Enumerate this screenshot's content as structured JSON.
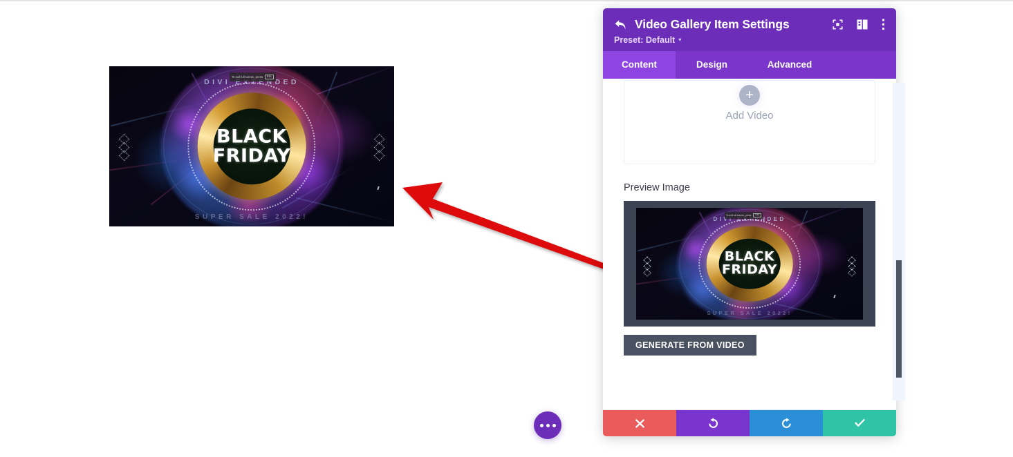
{
  "panel": {
    "title": "Video Gallery Item Settings",
    "back_icon": "back-arrow-icon",
    "header_icons": [
      "focus-target-icon",
      "panel-layout-icon",
      "vertical-dots-icon"
    ],
    "preset_label": "Preset: Default",
    "preset_caret": "▾",
    "tabs": [
      {
        "label": "Content",
        "active": true
      },
      {
        "label": "Design",
        "active": false
      },
      {
        "label": "Advanced",
        "active": false
      }
    ],
    "add_video": {
      "plus_glyph": "+",
      "label": "Add Video"
    },
    "preview_image": {
      "section_label": "Preview Image",
      "generate_button": "GENERATE FROM VIDEO"
    },
    "action_bar": [
      {
        "name": "cancel",
        "glyph": "✖",
        "color": "#ea5c5c"
      },
      {
        "name": "undo",
        "glyph": "↺",
        "color": "#7a35cf"
      },
      {
        "name": "redo",
        "glyph": "↻",
        "color": "#2a8fd6"
      },
      {
        "name": "save",
        "glyph": "✔",
        "color": "#2fc4a5"
      }
    ]
  },
  "canvas": {
    "fab_label": "•••",
    "video_slide": {
      "top_title": "DIVI EXTENDED",
      "center_line_1": "BLACK",
      "center_line_2": "FRIDAY",
      "bottom_title": "SUPER SALE 2022!",
      "fullscreen_tooltip": "To exit full screen, press",
      "fullscreen_key": "Esc"
    }
  },
  "annotations": {
    "arrow_1_target": "canvas-video-preview",
    "arrow_2_target": "generate-from-video-button",
    "arrow_color": "#dd0b0b"
  },
  "colors": {
    "brand_purple": "#6c2eb9",
    "tab_bar": "#7b35cb",
    "tab_active": "#8e44e0",
    "dark_slate": "#3c4352",
    "button_slate": "#4a5160",
    "arrow_red": "#dd0b0b"
  }
}
